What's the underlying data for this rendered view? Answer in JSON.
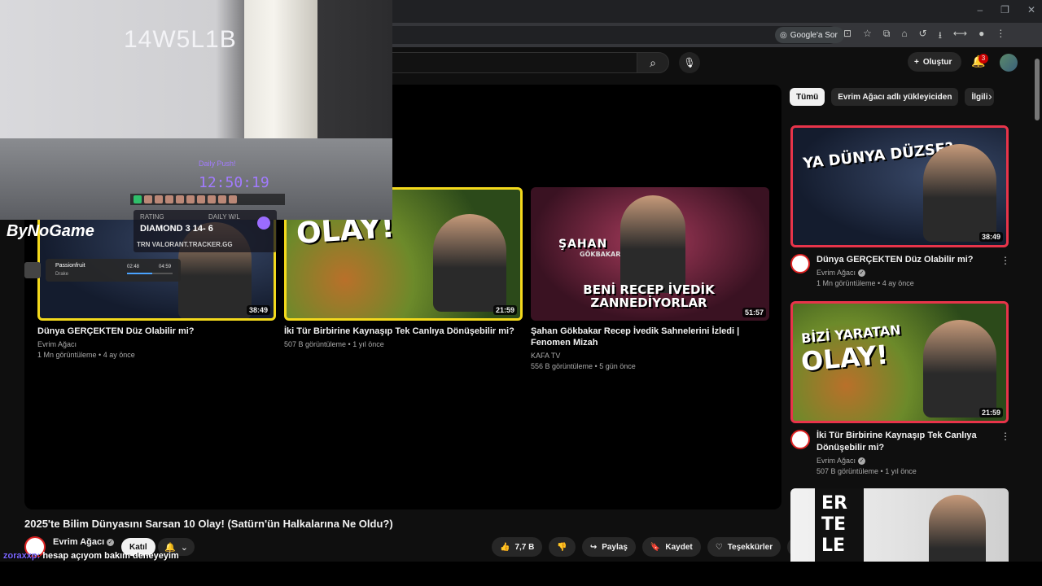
{
  "browser": {
    "google_sor_label": "Google'a Sor",
    "window_controls": [
      "–",
      "❐",
      "✕"
    ]
  },
  "header": {
    "create_label": "Oluştur",
    "notifications_count": "3"
  },
  "end_cards": [
    {
      "title": "Dünya GERÇEKTEN Düz Olabilir mi?",
      "channel": "Evrim Ağacı",
      "meta": "1 Mn görüntüleme • 4 ay önce",
      "duration": "38:49"
    },
    {
      "title": "İki Tür Birbirine Kaynaşıp Tek Canlıya Dönüşebilir mi?",
      "channel": "Evrim Ağacı",
      "meta": "507 B görüntüleme • 1 yıl önce",
      "duration": "21:59",
      "overlay": "OLAY!"
    },
    {
      "title": "Şahan Gökbakar Recep İvedik Sahnelerini İzledi | Fenomen Mizah",
      "channel": "KAFA TV",
      "meta": "556 B görüntüleme • 5 gün önce",
      "duration": "51:57",
      "overlay_name": "ŞAHAN",
      "overlay_name_sub": "GÖKBAKAR",
      "overlay_text": "BENİ RECEP İVEDİK ZANNEDİYORLAR"
    }
  ],
  "video": {
    "title": "2025'te Bilim Dünyasını Sarsan 10 Olay! (Satürn'ün Halkalarına Ne Oldu?)",
    "channel": "Evrim Ağacı",
    "join_label": "Katıl",
    "like_count": "7,7 B",
    "share_label": "Paylaş",
    "save_label": "Kaydet",
    "thanks_label": "Teşekkürler"
  },
  "sidebar": {
    "chips": [
      "Tümü",
      "Evrim Ağacı adlı yükleyiciden",
      "İlgili"
    ],
    "items": [
      {
        "title": "Dünya GERÇEKTEN Düz Olabilir mi?",
        "channel": "Evrim Ağacı",
        "meta": "1 Mn görüntüleme • 4 ay önce",
        "duration": "38:49",
        "overlay": "YA DÜNYA DÜZSE?"
      },
      {
        "title": "İki Tür Birbirine Kaynaşıp Tek Canlıya Dönüşebilir mi?",
        "channel": "Evrim Ağacı",
        "meta": "507 B görüntüleme • 1 yıl önce",
        "duration": "21:59",
        "overlay_top": "BİZİ YARATAN",
        "overlay": "OLAY!"
      },
      {
        "overlay": "ER TE LE"
      }
    ]
  },
  "stream_overlay": {
    "cam_code": "14W5L1B",
    "timer_label": "Daily Push!",
    "timer_value": "12:50:19",
    "rating_label": "RATING",
    "daily_label": "DAILY W/L",
    "rank_text": "DIAMOND 3   14- 6",
    "trn_text": "TRN  VALORANT.TRACKER.GG",
    "brand": "ByNoGame",
    "song_title": "Passionfruit",
    "song_artist": "Drake",
    "song_elapsed": "02:48",
    "song_total": "04:59",
    "song_progress": 0.56,
    "chat_user": "zoraxxp:",
    "chat_message": "hesap açıyom bakım deneyeyim"
  }
}
